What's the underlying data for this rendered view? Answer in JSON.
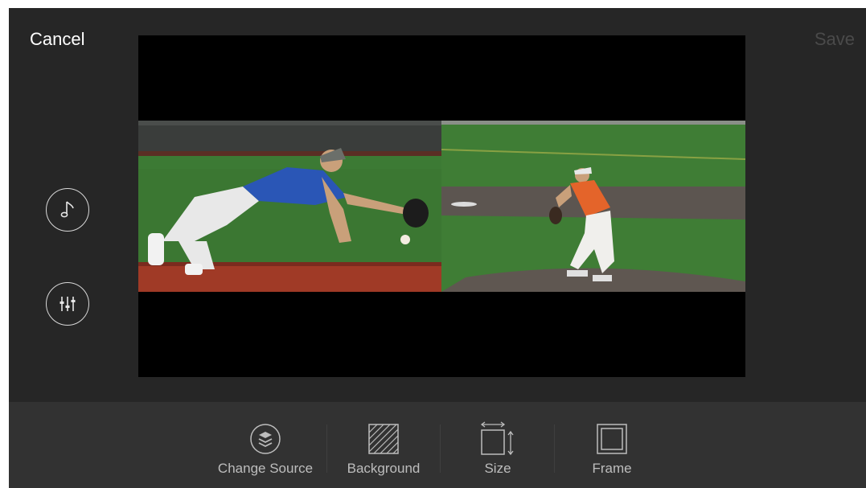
{
  "header": {
    "cancel_label": "Cancel",
    "save_label": "Save"
  },
  "side_controls": [
    {
      "name": "music",
      "icon": "music-note-icon"
    },
    {
      "name": "audio-mixer",
      "icon": "mixer-sliders-icon"
    }
  ],
  "toolbar": {
    "change_source_label": "Change Source",
    "background_label": "Background",
    "size_label": "Size",
    "frame_label": "Frame"
  },
  "colors": {
    "app_bg": "#262626",
    "toolbar_bg": "#323232",
    "text_primary": "#ffffff",
    "text_disabled": "#4a4a4a",
    "toolbar_text": "#bdbdbd"
  }
}
